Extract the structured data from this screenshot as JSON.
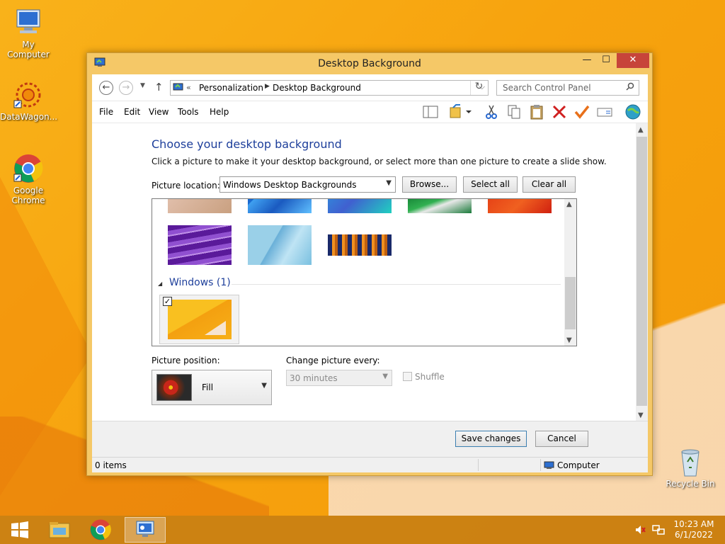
{
  "desktop": {
    "icons": [
      {
        "label": "My Computer"
      },
      {
        "label": "DataWagon..."
      },
      {
        "label": "Google Chrome"
      },
      {
        "label": "Recycle Bin"
      }
    ]
  },
  "window": {
    "title": "Desktop Background",
    "controls": {
      "minimize": "—",
      "maximize": "☐",
      "close": "✕"
    }
  },
  "address_bar": {
    "overflow": "«",
    "breadcrumbs": [
      "Personalization",
      "Desktop Background"
    ],
    "search_placeholder": "Search Control Panel"
  },
  "menu": {
    "items": [
      "File",
      "Edit",
      "View",
      "Tools",
      "Help"
    ]
  },
  "toolbar_icons": [
    "layout-icon",
    "folder-check-icon",
    "cut-icon",
    "copy-icon",
    "paste-icon",
    "delete-icon",
    "properties-check-icon",
    "rename-icon",
    "globe-icon"
  ],
  "content": {
    "heading": "Choose your desktop background",
    "description": "Click a picture to make it your desktop background, or select more than one picture to create a slide show.",
    "picture_location_label": "Picture location:",
    "picture_location_value": "Windows Desktop Backgrounds",
    "browse_label": "Browse...",
    "select_all_label": "Select all",
    "clear_all_label": "Clear all",
    "group_label": "Windows (1)",
    "selected_checked": true,
    "picture_position_label": "Picture position:",
    "picture_position_value": "Fill",
    "change_every_label": "Change picture every:",
    "change_every_value": "30 minutes",
    "shuffle_label": "Shuffle",
    "shuffle_checked": false
  },
  "footer": {
    "save_label": "Save changes",
    "cancel_label": "Cancel"
  },
  "status": {
    "items": "0 items",
    "location": "Computer"
  },
  "taskbar": {
    "time": "10:23 AM",
    "date": "6/1/2022"
  },
  "colors": {
    "heading": "#1e3f9b",
    "close_button": "#c7443a",
    "window_frame": "#f5c867"
  }
}
